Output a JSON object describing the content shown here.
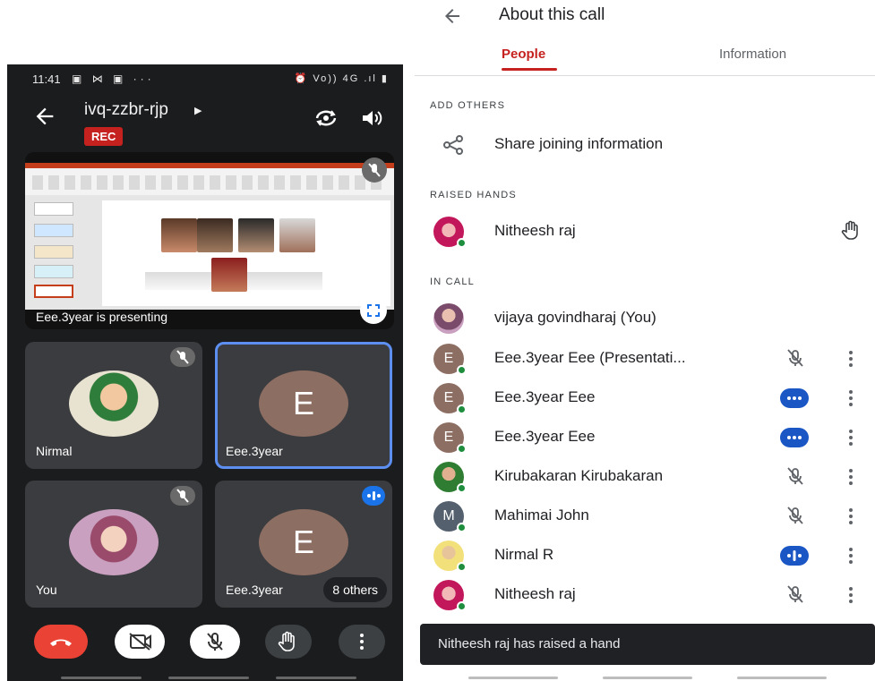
{
  "left": {
    "status_time": "11:41",
    "status_left_icons": "▣ ⋈ ▣ ···",
    "status_right": "⏰ Vo)) 4G .ıl ▮",
    "meeting_code": "ivq-zzbr-rjp",
    "rec_label": "REC",
    "presenting_caption": "Eee.3year is presenting",
    "tiles": [
      {
        "name": "Nirmal"
      },
      {
        "name": "Eee.3year",
        "letter": "E"
      },
      {
        "name": "You"
      },
      {
        "name": "Eee.3year",
        "letter": "E",
        "others": "8 others"
      }
    ],
    "colors": {
      "hangup": "#ea4335",
      "speaking": "#1a73e8",
      "rec": "#c5221f"
    }
  },
  "right": {
    "title": "About this call",
    "tabs": [
      "People",
      "Information"
    ],
    "sections": {
      "add_others": "ADD OTHERS",
      "raised_hands": "RAISED HANDS",
      "in_call": "IN CALL"
    },
    "share_label": "Share joining information",
    "raised": [
      {
        "name": "Nitheesh raj",
        "icon": "raised-hand-icon"
      }
    ],
    "in_call": [
      {
        "name": "vijaya govindharaj (You)",
        "avatar": "photo-pink",
        "status": "none"
      },
      {
        "name": "Eee.3year Eee (Presentati...",
        "avatar": "E",
        "status": "muted"
      },
      {
        "name": "Eee.3year Eee",
        "avatar": "E",
        "status": "dots"
      },
      {
        "name": "Eee.3year Eee",
        "avatar": "E",
        "status": "dots"
      },
      {
        "name": "Kirubakaran Kirubakaran",
        "avatar": "photo-green",
        "status": "muted"
      },
      {
        "name": "Mahimai John",
        "avatar": "M",
        "status": "muted"
      },
      {
        "name": "Nirmal R",
        "avatar": "photo-yellow",
        "status": "speaking"
      },
      {
        "name": "Nitheesh raj",
        "avatar": "photo-red",
        "status": "muted"
      }
    ],
    "toast": "Nitheesh raj has raised a hand",
    "colors": {
      "accent": "#c5221f",
      "online": "#1e8e3e"
    }
  }
}
